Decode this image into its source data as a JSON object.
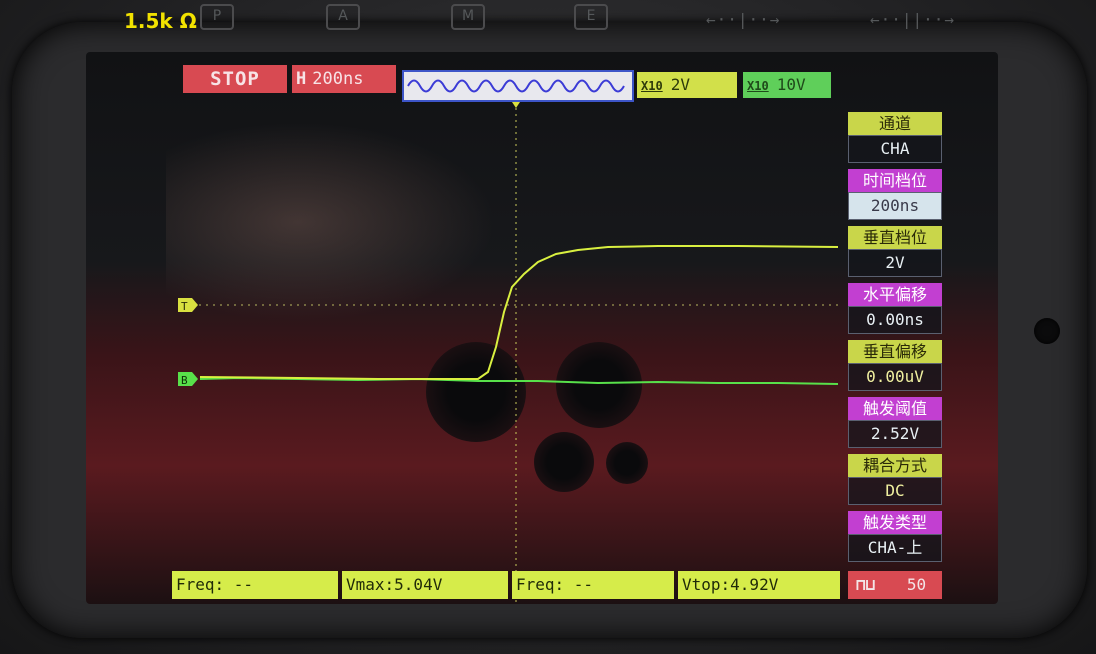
{
  "overlay_label": "1.5k Ω",
  "hardware_buttons": [
    "P",
    "A",
    "M",
    "E"
  ],
  "hardware_arrows": [
    "←··|··→",
    "←··||··→"
  ],
  "status": {
    "run_state": "STOP",
    "timebase_prefix": "H",
    "timebase": "200ns"
  },
  "channels": {
    "ch1": {
      "probe": "X10",
      "volts_per_div": "2V",
      "color": "#d2e04a"
    },
    "ch2": {
      "probe": "X10",
      "volts_per_div": "10V",
      "color": "#5fcf5a"
    }
  },
  "markers": {
    "trigger_marker": "T",
    "ground_marker": "B"
  },
  "menu": [
    {
      "title": "通道",
      "value": "CHA",
      "title_color": "#c9d64a",
      "value_color": "#e8f0f4"
    },
    {
      "title": "时间档位",
      "value": "200ns",
      "title_color": "#c23fd1",
      "value_color": "#e8f0f4"
    },
    {
      "title": "垂直档位",
      "value": "2V",
      "title_color": "#c9d64a",
      "value_color": "#e8f0f4"
    },
    {
      "title": "水平偏移",
      "value": "0.00ns",
      "title_color": "#c23fd1",
      "value_color": "#e8f0f4"
    },
    {
      "title": "垂直偏移",
      "value": "0.00uV",
      "title_color": "#c9d64a",
      "value_color": "#f0f0a0"
    },
    {
      "title": "触发阈值",
      "value": "2.52V",
      "title_color": "#c23fd1",
      "value_color": "#e8f0f4"
    },
    {
      "title": "耦合方式",
      "value": "DC",
      "title_color": "#c9d64a",
      "value_color": "#f0f0a0"
    },
    {
      "title": "触发类型",
      "value": "CHA-上",
      "title_color": "#c23fd1",
      "value_color": "#e8f0f4"
    }
  ],
  "measurements": {
    "ch1_freq": "Freq: --",
    "ch1_vmax": "Vmax:5.04V",
    "ch2_freq": "Freq: --",
    "ch2_vtop": "Vtop:4.92V",
    "trigger_counter": "50"
  },
  "colors": {
    "waveform_ch1": "#d9f040",
    "waveform_ch2": "#58e04a",
    "badge_red": "#d84a52",
    "menu_purple": "#c23fd1"
  }
}
